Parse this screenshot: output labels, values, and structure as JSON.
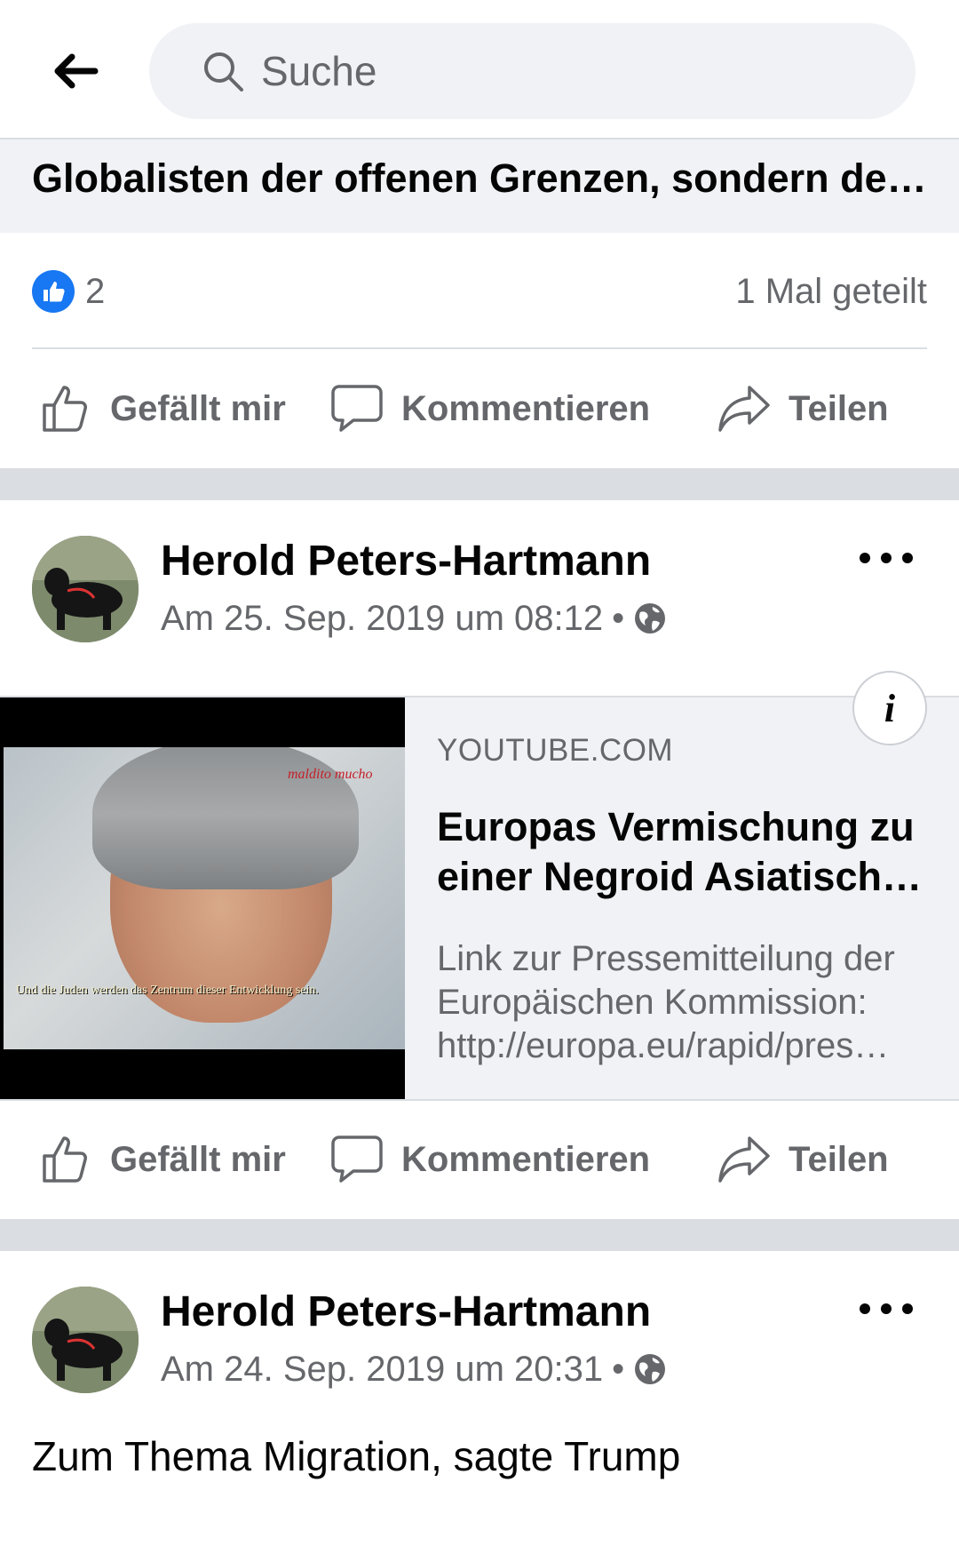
{
  "search": {
    "placeholder": "Suche"
  },
  "prev_post": {
    "link_title": "Globalisten der offenen Grenzen, sondern de…",
    "reaction_count": "2",
    "share_count": "1 Mal geteilt"
  },
  "actions": {
    "like": "Gefällt mir",
    "comment": "Kommentieren",
    "share": "Teilen"
  },
  "post1": {
    "author": "Herold Peters-Hartmann",
    "timestamp": "Am 25. Sep. 2019 um 08:12",
    "link": {
      "domain": "YOUTUBE.COM",
      "title_line1": "Europas Vermischung zu",
      "title_line2": "einer Negroid Asiatisch…",
      "desc_line1": "Link zur Pressemitteilung der",
      "desc_line2": "Europäischen Kommission:",
      "desc_line3": "http://europa.eu/rapid/pres…",
      "thumb_caption": "Und die Juden werden das Zentrum dieser Entwicklung sein.",
      "thumb_watermark": "maldito mucho"
    }
  },
  "post2": {
    "author": "Herold Peters-Hartmann",
    "timestamp": "Am 24. Sep. 2019 um 20:31",
    "text": "Zum Thema Migration, sagte Trump"
  },
  "colors": {
    "accent": "#1877f2",
    "secondary_text": "#65676b",
    "separator": "#dadde1",
    "card_bg": "#f0f2f5"
  }
}
